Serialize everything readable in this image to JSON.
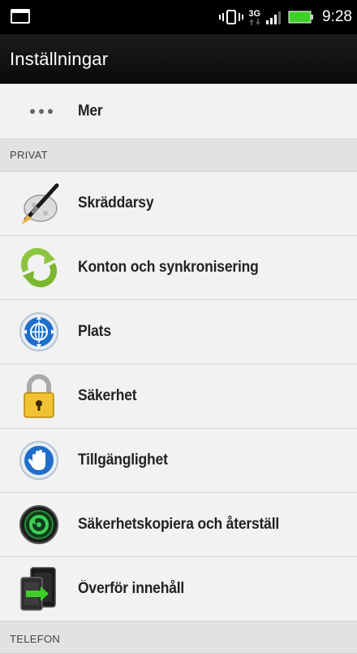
{
  "status_bar": {
    "network_type": "3G",
    "time": "9:28"
  },
  "app_bar": {
    "title": "Inställningar"
  },
  "more_row": {
    "label": "Mer"
  },
  "sections": [
    {
      "label": "PRIVAT",
      "items": [
        {
          "label": "Skräddarsy",
          "icon": "paintbrush-icon"
        },
        {
          "label": "Konton och synkronisering",
          "icon": "sync-icon"
        },
        {
          "label": "Plats",
          "icon": "globe-icon"
        },
        {
          "label": "Säkerhet",
          "icon": "padlock-icon"
        },
        {
          "label": "Tillgänglighet",
          "icon": "hand-icon"
        },
        {
          "label": "Säkerhetskopiera och återställ",
          "icon": "backup-icon"
        },
        {
          "label": "Överför innehåll",
          "icon": "transfer-icon"
        }
      ]
    },
    {
      "label": "TELEFON",
      "items": []
    }
  ],
  "colors": {
    "background": "#f2f2f2",
    "section_header": "#e2e2e2",
    "status_bar": "#000000",
    "battery_green": "#3fcf29"
  }
}
